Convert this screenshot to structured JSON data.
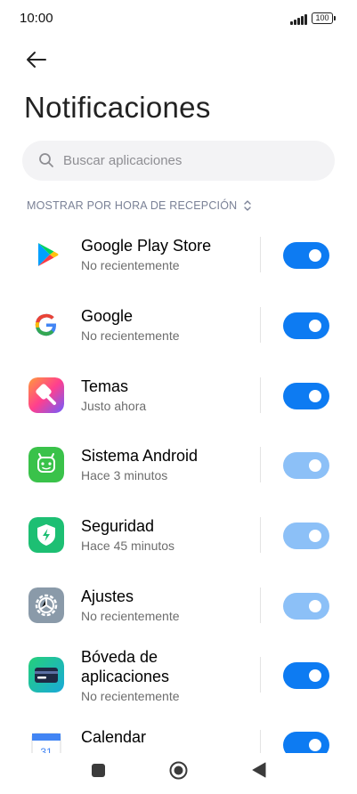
{
  "status": {
    "time": "10:00",
    "battery": "100"
  },
  "header": {
    "title": "Notificaciones"
  },
  "search": {
    "placeholder": "Buscar aplicaciones"
  },
  "sort": {
    "label": "MOSTRAR POR HORA DE RECEPCIÓN"
  },
  "apps": [
    {
      "name": "Google Play Store",
      "subtitle": "No recientemente",
      "icon": "google-play-store-icon",
      "enabled": true,
      "dimmed": false
    },
    {
      "name": "Google",
      "subtitle": "No recientemente",
      "icon": "google-icon",
      "enabled": true,
      "dimmed": false
    },
    {
      "name": "Temas",
      "subtitle": "Justo ahora",
      "icon": "themes-icon",
      "enabled": true,
      "dimmed": false
    },
    {
      "name": "Sistema Android",
      "subtitle": "Hace 3 minutos",
      "icon": "android-system-icon",
      "enabled": true,
      "dimmed": true
    },
    {
      "name": "Seguridad",
      "subtitle": "Hace 45 minutos",
      "icon": "security-icon",
      "enabled": true,
      "dimmed": true
    },
    {
      "name": "Ajustes",
      "subtitle": "No recientemente",
      "icon": "settings-icon",
      "enabled": true,
      "dimmed": true
    },
    {
      "name_line1": "Bóveda de",
      "name_line2": "aplicaciones",
      "subtitle": "No recientemente",
      "icon": "app-vault-icon",
      "enabled": true,
      "dimmed": false
    },
    {
      "name": "Calendar",
      "icon": "calendar-icon",
      "icon_text": "31",
      "enabled": true,
      "dimmed": false
    }
  ],
  "colors": {
    "toggle_on": "#0d7bf2",
    "toggle_dimmed": "#8cc0f7",
    "sort_text": "#7a8196"
  }
}
